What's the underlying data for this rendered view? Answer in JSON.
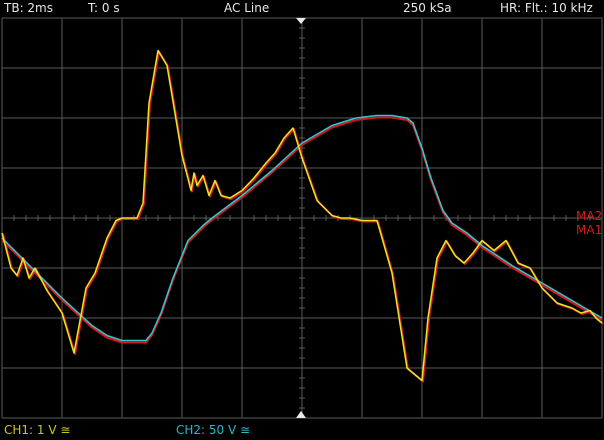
{
  "header": {
    "timebase": "TB: 2ms",
    "trigger_time": "T: 0 s",
    "trigger_source": "AC Line",
    "sample_rate": "250 kSa",
    "acquisition_mode": "HR: Flt.: 10 kHz"
  },
  "footer": {
    "ch1_label": "CH1: 1 V ≅",
    "ch2_label": "CH2: 50 V ≅"
  },
  "math_labels": {
    "ma2": "MA2",
    "ma1": "MA1"
  },
  "colors": {
    "ch1": "#e6e62a",
    "ch2": "#35c6d6",
    "math": "#d21a1a",
    "grid": "#5a5a5a",
    "text": "#e8e8e8"
  },
  "icons": {
    "trigger_marker_top": "triangle-down",
    "trigger_marker_bottom": "triangle-up"
  },
  "chart_data": {
    "type": "line",
    "grid": true,
    "grid_divisions": {
      "x": 10,
      "y": 8
    },
    "x_unit": "ms",
    "x_range": [
      -10,
      10
    ],
    "series": [
      {
        "name": "CH1",
        "y_unit": "div",
        "x": [
          -10,
          -9.7,
          -9.5,
          -9.3,
          -9.1,
          -8.9,
          -8.5,
          -8,
          -7.6,
          -7.2,
          -6.9,
          -6.5,
          -6.2,
          -6,
          -5.9,
          -5.7,
          -5.5,
          -5.3,
          -5.1,
          -4.8,
          -4.5,
          -4,
          -3.7,
          -3.6,
          -3.5,
          -3.3,
          -3.1,
          -2.9,
          -2.7,
          -2.4,
          -2,
          -1.6,
          -1.2,
          -0.9,
          -0.6,
          -0.3,
          0,
          0.5,
          1,
          1.3,
          1.6,
          2,
          2.5,
          3,
          3.5,
          4,
          4.2,
          4.5,
          4.8,
          5.1,
          5.4,
          5.7,
          6,
          6.4,
          6.8,
          7.2,
          7.6,
          8,
          8.5,
          9,
          9.3,
          9.6,
          9.8,
          10
        ],
        "y": [
          -0.3,
          -1.0,
          -1.15,
          -0.8,
          -1.2,
          -1.0,
          -1.45,
          -1.9,
          -2.7,
          -1.4,
          -1.1,
          -0.4,
          -0.05,
          0,
          0,
          0,
          0,
          0.3,
          2.3,
          3.35,
          3.05,
          1.25,
          0.55,
          0.9,
          0.65,
          0.85,
          0.45,
          0.75,
          0.45,
          0.4,
          0.55,
          0.8,
          1.1,
          1.3,
          1.6,
          1.8,
          1.2,
          0.35,
          0.05,
          0,
          0,
          -0.05,
          -0.05,
          -1.1,
          -3.0,
          -3.25,
          -2.0,
          -0.8,
          -0.45,
          -0.75,
          -0.9,
          -0.7,
          -0.45,
          -0.65,
          -0.45,
          -0.9,
          -1.0,
          -1.4,
          -1.7,
          -1.8,
          -1.9,
          -1.85,
          -2.0,
          -2.1
        ]
      },
      {
        "name": "CH2",
        "y_unit": "div",
        "x": [
          -10,
          -9,
          -8,
          -7,
          -6.5,
          -6,
          -5.5,
          -5.2,
          -5,
          -4.7,
          -4.3,
          -3.8,
          -3.3,
          -3,
          -2,
          -1,
          0,
          1,
          1.8,
          2.5,
          3,
          3.5,
          3.7,
          4,
          4.3,
          4.7,
          5,
          5.5,
          6,
          7,
          8,
          9,
          10
        ],
        "y": [
          -0.4,
          -1.0,
          -1.6,
          -2.15,
          -2.35,
          -2.45,
          -2.45,
          -2.45,
          -2.3,
          -1.9,
          -1.2,
          -0.45,
          -0.15,
          0,
          0.45,
          0.95,
          1.5,
          1.85,
          2.0,
          2.05,
          2.05,
          2.0,
          1.9,
          1.4,
          0.8,
          0.15,
          -0.1,
          -0.3,
          -0.55,
          -0.95,
          -1.3,
          -1.65,
          -2.0
        ]
      }
    ],
    "math_series": [
      "MA2",
      "MA1"
    ]
  }
}
